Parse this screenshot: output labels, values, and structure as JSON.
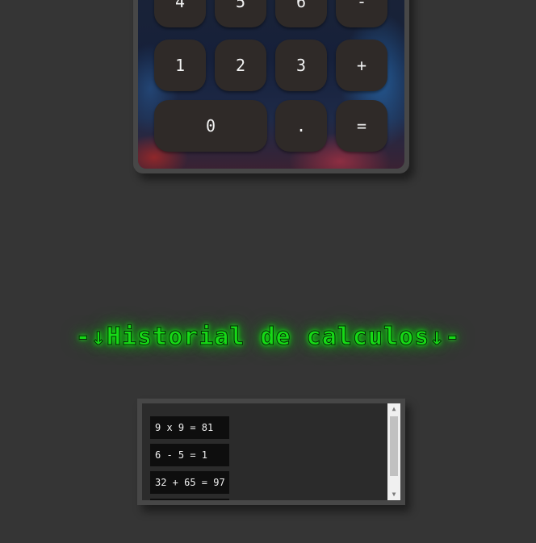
{
  "keypad": {
    "row_top": [
      "4",
      "5",
      "6",
      "-"
    ],
    "row_mid": [
      "1",
      "2",
      "3",
      "+"
    ],
    "row_bottom": [
      "0",
      ".",
      "="
    ]
  },
  "history": {
    "title": "-↓Historial de calculos↓-",
    "items": [
      "9 x 9 = 81",
      "6 - 5 = 1",
      "32 + 65 = 97",
      ""
    ]
  },
  "scrollbar": {
    "up_icon": "▲",
    "down_icon": "▼"
  }
}
